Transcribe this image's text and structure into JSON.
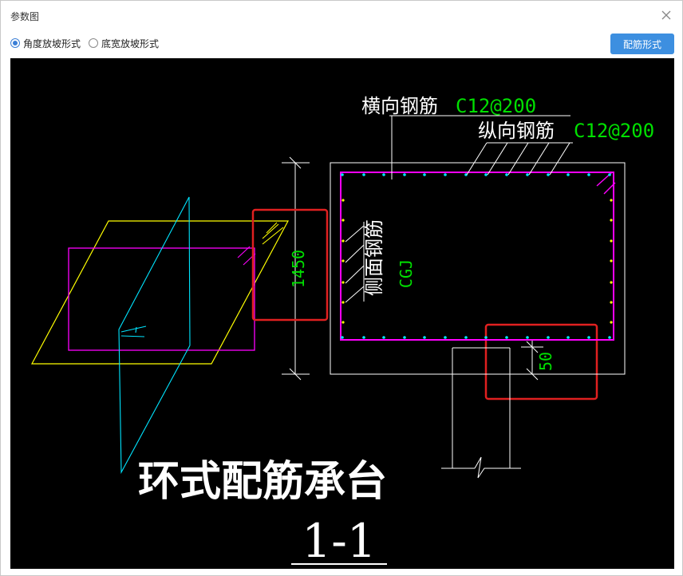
{
  "window": {
    "title": "参数图"
  },
  "toolbar": {
    "radio_options": [
      {
        "label": "角度放坡形式",
        "checked": true
      },
      {
        "label": "底宽放坡形式",
        "checked": false
      }
    ],
    "rebar_form_button": "配筋形式"
  },
  "drawing": {
    "labels": {
      "transverse_rebar": "横向钢筋",
      "transverse_rebar_spec": "C12@200",
      "longitudinal_rebar": "纵向钢筋",
      "longitudinal_rebar_spec": "C12@200",
      "side_rebar": "侧面钢筋",
      "side_rebar_code": "CGJ",
      "height_dim": "1450",
      "cover_dim": "50",
      "main_title": "环式配筋承台",
      "section_label": "1-1"
    },
    "colors": {
      "background": "#000000",
      "white": "#ffffff",
      "green": "#00e000",
      "magenta": "#ff00ff",
      "yellow": "#ffff00",
      "cyan": "#00e5ff",
      "red_highlight": "#e02020",
      "primary_button": "#3d8fe0"
    }
  }
}
